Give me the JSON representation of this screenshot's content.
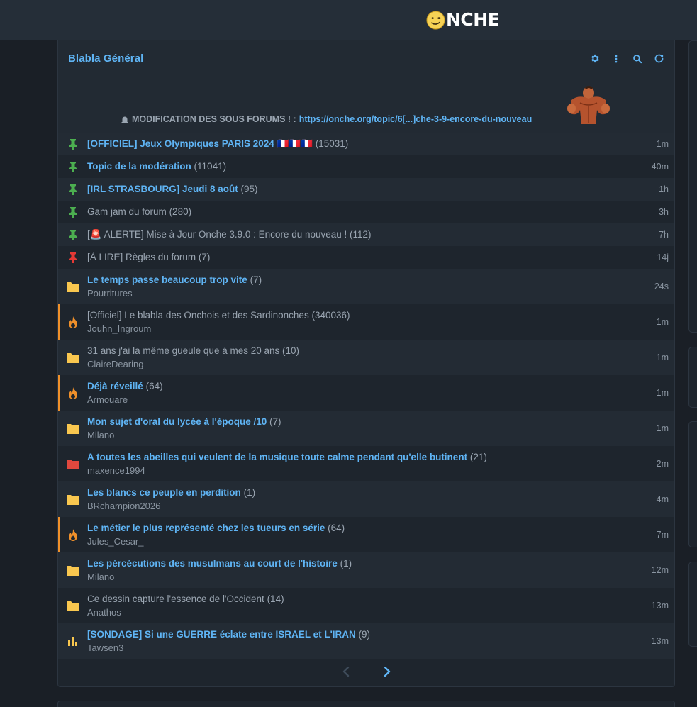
{
  "site": {
    "logo_text": "NCHE"
  },
  "forum": {
    "title": "Blabla Général"
  },
  "header_icons": [
    "gear-icon",
    "more-vertical-icon",
    "search-icon",
    "refresh-icon"
  ],
  "announcement": {
    "icon": "rotating-light-emoji",
    "text": "MODIFICATION DES SOUS FORUMS ! :",
    "link": "https://onche.org/topic/6[...]che-3-9-encore-du-nouveau"
  },
  "pinned": [
    {
      "title": "[OFFICIEL] Jeux Olympiques PARIS 2024 🇫🇷🇫🇷🇫🇷",
      "count": "(15031)",
      "time": "1m",
      "bold": true,
      "icon": "pin-green-icon"
    },
    {
      "title": "Topic de la modération",
      "count": "(11041)",
      "time": "40m",
      "bold": true,
      "icon": "pin-green-icon"
    },
    {
      "title": "[IRL STRASBOURG] Jeudi 8 août",
      "count": "(95)",
      "time": "1h",
      "bold": true,
      "icon": "pin-green-icon"
    },
    {
      "title": "Gam jam du forum",
      "count": "(280)",
      "time": "3h",
      "bold": false,
      "icon": "pin-green-icon"
    },
    {
      "title": "[🚨 ALERTE] Mise à Jour Onche 3.9.0 : Encore du nouveau !",
      "count": "(112)",
      "time": "7h",
      "bold": false,
      "icon": "pin-green-icon"
    },
    {
      "title": "[À LIRE] Règles du forum",
      "count": "(7)",
      "time": "14j",
      "bold": false,
      "icon": "pin-red-icon"
    }
  ],
  "topics": [
    {
      "title": "Le temps passe beaucoup trop vite",
      "count": "(7)",
      "author": "Pourritures",
      "time": "24s",
      "bold": true,
      "icon": "folder-yellow-icon",
      "hot": false
    },
    {
      "title": "[Officiel] Le blabla des Onchois et des Sardinonches",
      "count": "(340036)",
      "author": "Jouhn_Ingroum",
      "time": "1m",
      "bold": false,
      "icon": "flame-icon",
      "hot": true
    },
    {
      "title": "31 ans j'ai la même gueule que à mes 20 ans",
      "count": "(10)",
      "author": "ClaireDearing",
      "time": "1m",
      "bold": false,
      "icon": "folder-yellow-icon",
      "hot": false
    },
    {
      "title": "Déjà réveillé",
      "count": "(64)",
      "author": "Armouare",
      "time": "1m",
      "bold": true,
      "icon": "flame-icon",
      "hot": true
    },
    {
      "title": "Mon sujet d'oral du lycée à l'époque /10",
      "count": "(7)",
      "author": "Milano",
      "time": "1m",
      "bold": true,
      "icon": "folder-yellow-icon",
      "hot": false
    },
    {
      "title": "A toutes les abeilles qui veulent de la musique toute calme pendant qu'elle butinent",
      "count": "(21)",
      "author": "maxence1994",
      "time": "2m",
      "bold": true,
      "icon": "folder-red-icon",
      "hot": false
    },
    {
      "title": "Les blancs ce peuple en perdition",
      "count": "(1)",
      "author": "BRchampion2026",
      "time": "4m",
      "bold": true,
      "icon": "folder-yellow-icon",
      "hot": false
    },
    {
      "title": "Le métier le plus représenté chez les tueurs en série",
      "count": "(64)",
      "author": "Jules_Cesar_",
      "time": "7m",
      "bold": true,
      "icon": "flame-icon",
      "hot": true
    },
    {
      "title": "Les pércécutions des musulmans au court de l'histoire",
      "count": "(1)",
      "author": "Milano",
      "time": "12m",
      "bold": true,
      "icon": "folder-yellow-icon",
      "hot": false
    },
    {
      "title": "Ce dessin capture l'essence de l'Occident",
      "count": "(14)",
      "author": "Anathos",
      "time": "13m",
      "bold": false,
      "icon": "folder-yellow-icon",
      "hot": false
    },
    {
      "title": "[SONDAGE] Si une GUERRE éclate entre ISRAEL et L'IRAN",
      "count": "(9)",
      "author": "Tawsen3",
      "time": "13m",
      "bold": true,
      "icon": "poll-icon",
      "hot": false
    }
  ],
  "pager": {
    "prev_icon": "chevron-left-icon",
    "next_icon": "chevron-right-icon"
  },
  "colors": {
    "accent": "#5fb4f4",
    "pin_green": "#4caf50",
    "pin_red": "#e53935",
    "folder_yellow": "#f9c74f",
    "folder_red": "#e0483e",
    "flame": "#f0902a",
    "hot_border": "#f0902a"
  }
}
